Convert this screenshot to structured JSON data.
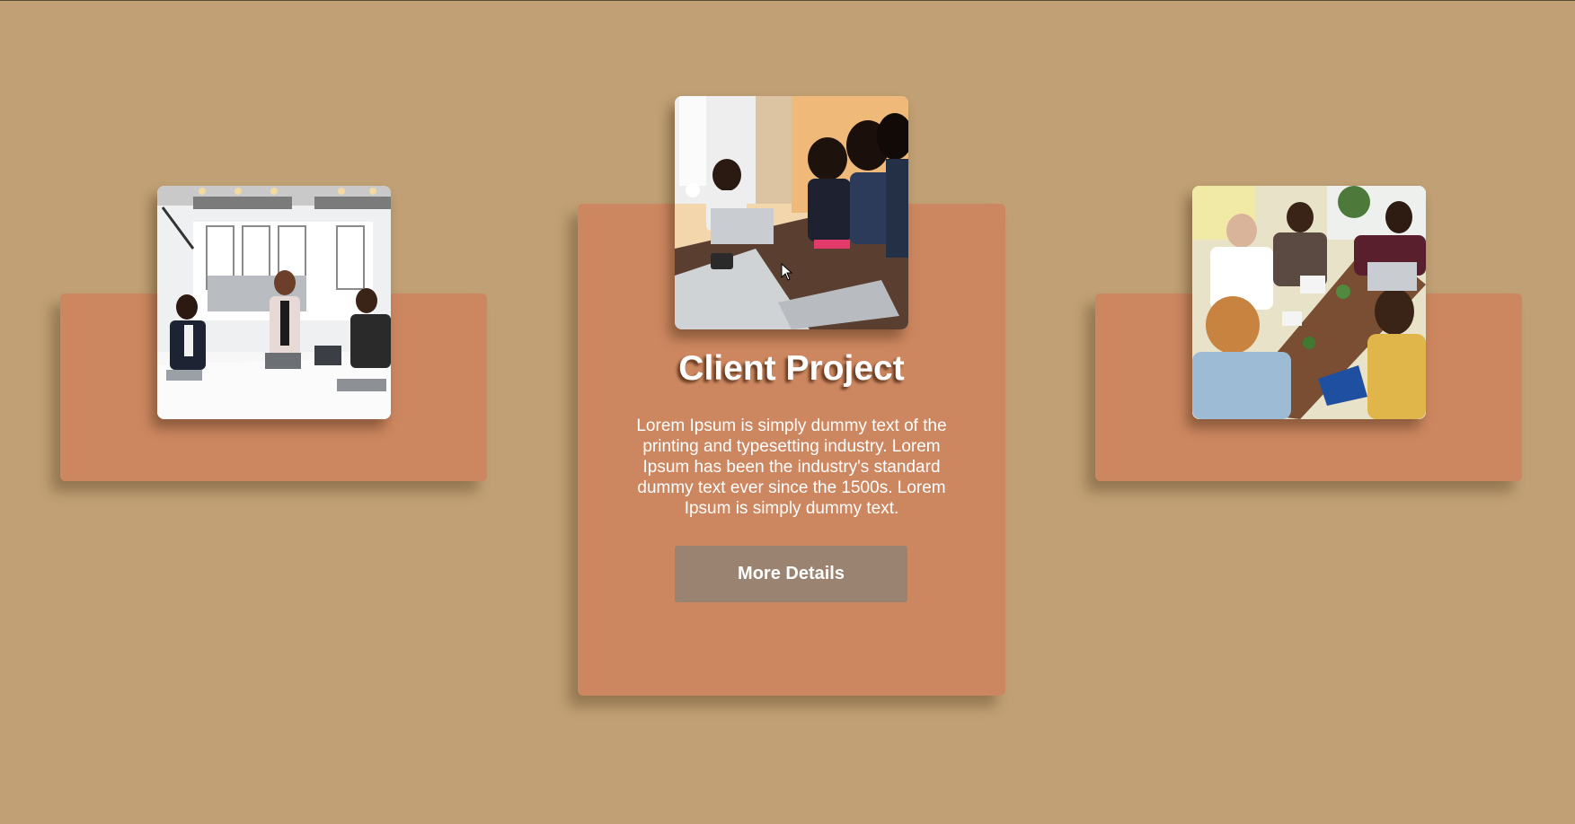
{
  "cards": {
    "left": {
      "image_icon": "office-meeting-photo"
    },
    "center": {
      "image_icon": "team-discussion-photo",
      "title": "Client Project",
      "description": "Lorem Ipsum is simply dummy text of the printing and typesetting industry. Lorem Ipsum has been the industry's standard dummy text ever since the 1500s. Lorem Ipsum is simply dummy text.",
      "button_label": "More Details"
    },
    "right": {
      "image_icon": "coworkers-table-photo"
    }
  },
  "colors": {
    "background": "#c0a074",
    "card": "#cd8760",
    "button": "#9a8471",
    "text": "#ffffff"
  }
}
